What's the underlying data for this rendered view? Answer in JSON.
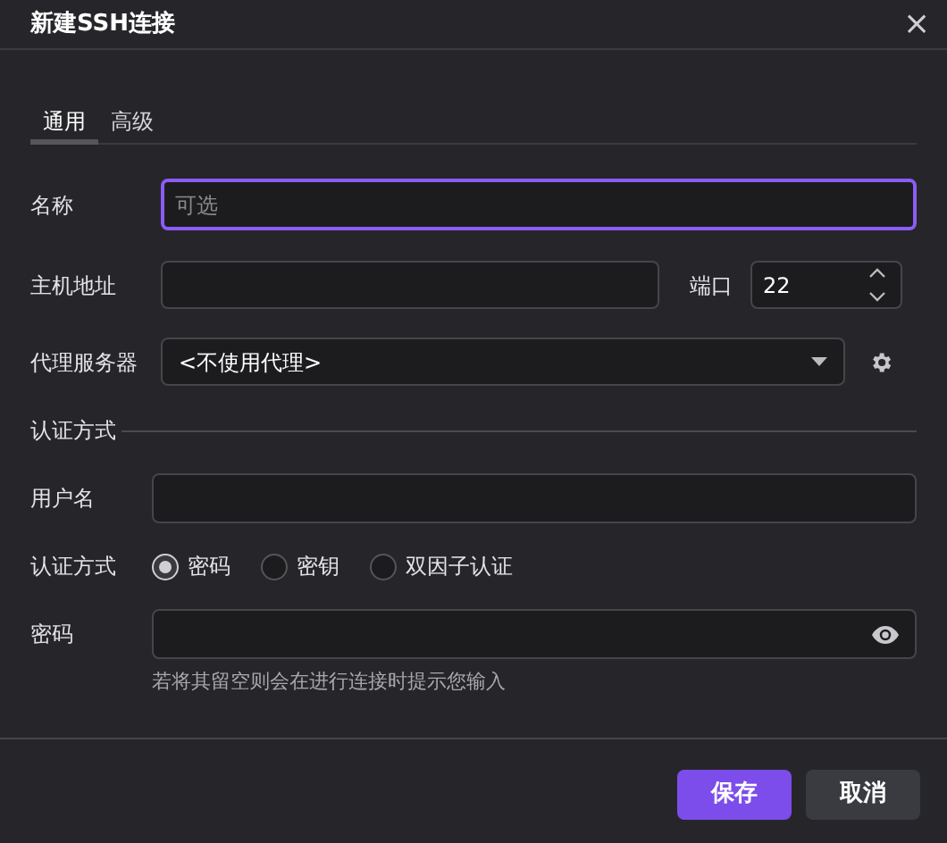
{
  "window": {
    "title": "新建SSH连接",
    "close": "×"
  },
  "tabs": [
    {
      "label": "通用",
      "selected": true
    },
    {
      "label": "高级",
      "selected": false
    }
  ],
  "name": {
    "label": "名称",
    "placeholder": "可选",
    "focused": true
  },
  "host": {
    "label": "主机地址"
  },
  "port": {
    "label": "端口",
    "value": "22"
  },
  "proxy": {
    "label": "代理服务器",
    "value": "<不使用代理>"
  },
  "auth_section": {
    "title": "认证方式"
  },
  "username": {
    "label": "用户名"
  },
  "auth_method": {
    "label": "认证方式",
    "options": [
      {
        "label": "密码",
        "selected": true
      },
      {
        "label": "密钥",
        "selected": false
      },
      {
        "label": "双因子认证",
        "selected": false
      }
    ]
  },
  "password": {
    "label": "密码",
    "hint": "若将其留空则会在进行连接时提示您输入"
  },
  "buttons": [
    {
      "label": "保存",
      "kind": "primary"
    },
    {
      "label": "取消",
      "kind": "secondary"
    }
  ]
}
